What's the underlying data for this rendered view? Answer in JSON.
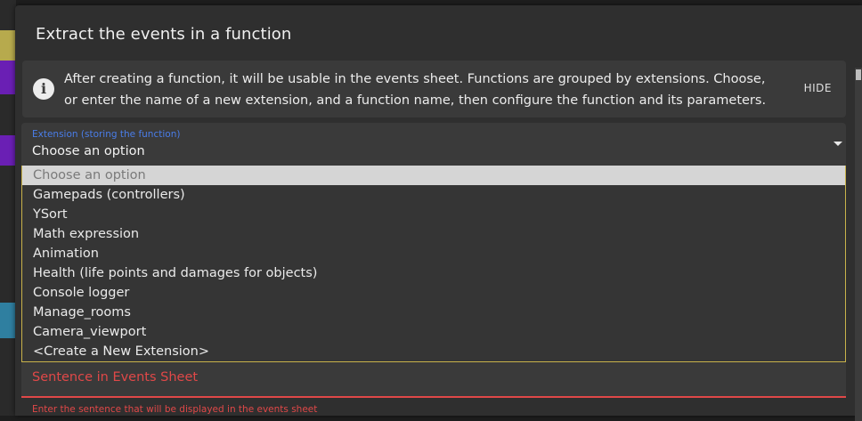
{
  "dialog": {
    "title": "Extract the events in a function",
    "info": {
      "text": "After creating a function, it will be usable in the events sheet. Functions are grouped by extensions. Choose, or enter the name of a new extension, and a function name, then configure the function and its parameters.",
      "hide_label": "HIDE"
    },
    "extension_select": {
      "label": "Extension (storing the function)",
      "value": "Choose an option",
      "options": [
        "Choose an option",
        "Gamepads (controllers)",
        "YSort",
        "Math expression",
        "Animation",
        "Health (life points and damages for objects)",
        "Console logger",
        "Manage_rooms",
        "Camera_viewport",
        "<Create a New Extension>"
      ]
    },
    "sentence_field": {
      "label": "Sentence in Events Sheet",
      "helper": "Enter the sentence that will be displayed in the events sheet"
    }
  },
  "colors": {
    "accent": "#4a7de8",
    "error": "#e04848",
    "dialog_bg": "#2f2f2f",
    "dropdown_border": "#c9b24a"
  },
  "icons": {
    "info": "info-icon",
    "caret": "caret-down-icon"
  }
}
